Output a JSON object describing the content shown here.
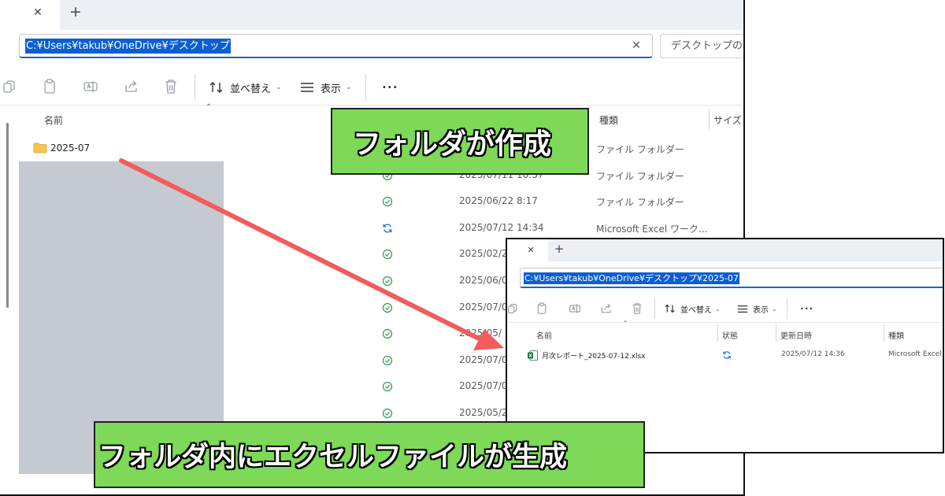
{
  "main_window": {
    "tab_close": "✕",
    "new_tab": "+",
    "address": "C:¥Users¥takub¥OneDrive¥デスクトップ",
    "address_clear": "✕",
    "search_placeholder": "デスクトップの検",
    "toolbar": {
      "sort_label": "並べ替え",
      "view_label": "表示",
      "more": "•••"
    },
    "columns": {
      "name": "名前",
      "type": "種類",
      "size": "サイズ"
    },
    "folder_name": "2025-07",
    "rows": [
      {
        "status": "synced",
        "date": "",
        "type": "ファイル フォルダー"
      },
      {
        "status": "synced",
        "date": "2025/07/11 10:37",
        "type": "ファイル フォルダー"
      },
      {
        "status": "synced",
        "date": "2025/06/22 8:17",
        "type": "ファイル フォルダー"
      },
      {
        "status": "syncing",
        "date": "2025/07/12 14:34",
        "type": "Microsoft Excel ワーク..."
      },
      {
        "status": "synced",
        "date": "2025/02/2",
        "type": ""
      },
      {
        "status": "synced",
        "date": "2025/06/0",
        "type": ""
      },
      {
        "status": "synced",
        "date": "2025/07/0",
        "type": ""
      },
      {
        "status": "synced",
        "date": "2025/05/",
        "type": ""
      },
      {
        "status": "synced",
        "date": "2025/07/0",
        "type": ""
      },
      {
        "status": "synced",
        "date": "2025/07/0",
        "type": ""
      },
      {
        "status": "synced",
        "date": "2025/05/2",
        "type": ""
      }
    ]
  },
  "sub_window": {
    "tab_close": "✕",
    "new_tab": "+",
    "address": "C:¥Users¥takub¥OneDrive¥デスクトップ¥2025-07",
    "toolbar": {
      "sort_label": "並べ替え",
      "view_label": "表示",
      "more": "•••"
    },
    "columns": {
      "name": "名前",
      "status": "状態",
      "modified": "更新日時",
      "type": "種類"
    },
    "file": {
      "name": "月次レポート_2025-07-12.xlsx",
      "status": "syncing",
      "modified": "2025/07/12 14:36",
      "type": "Microsoft Excel"
    }
  },
  "callouts": {
    "top": "フォルダが作成",
    "bottom": "フォルダ内にエクセルファイルが生成"
  },
  "colors": {
    "callout_bg": "#7dd957",
    "arrow": "#f25c5c",
    "selection": "#0b5fd4",
    "synced": "#2e9e4f",
    "syncing": "#1a73e8",
    "redaction": "#c5c9d2"
  }
}
